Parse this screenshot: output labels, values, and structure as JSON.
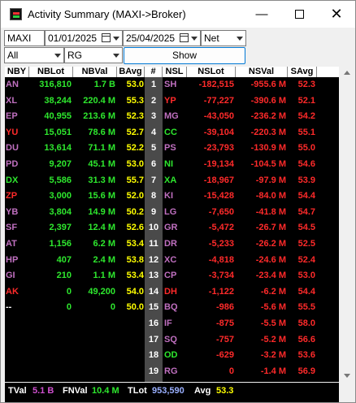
{
  "window": {
    "title": "Activity Summary (MAXI->Broker)"
  },
  "filters": {
    "code": "MAXI",
    "date_from": "01/01/2025",
    "date_to": "25/04/2025",
    "mode": "Net",
    "scope": "All",
    "board": "RG",
    "show_label": "Show"
  },
  "table": {
    "headers": [
      "NBY",
      "NBLot",
      "NBVal",
      "BAvg",
      "#",
      "NSL",
      "NSLot",
      "NSVal",
      "SAvg"
    ],
    "rows": [
      {
        "nby": "AN",
        "nblot": "316,810",
        "nbval": "1.7 B",
        "bavg": "53.0",
        "n": "1",
        "nsl": "SH",
        "nslot": "-182,515",
        "nsval": "-955.6 M",
        "savg": "52.3"
      },
      {
        "nby": "XL",
        "nblot": "38,244",
        "nbval": "220.4 M",
        "bavg": "55.3",
        "n": "2",
        "nsl": "YP",
        "nslot": "-77,227",
        "nsval": "-390.6 M",
        "savg": "52.1"
      },
      {
        "nby": "EP",
        "nblot": "40,955",
        "nbval": "213.6 M",
        "bavg": "52.3",
        "n": "3",
        "nsl": "MG",
        "nslot": "-43,050",
        "nsval": "-236.2 M",
        "savg": "54.2"
      },
      {
        "nby": "YU",
        "nblot": "15,051",
        "nbval": "78.6 M",
        "bavg": "52.7",
        "n": "4",
        "nsl": "CC",
        "nslot": "-39,104",
        "nsval": "-220.3 M",
        "savg": "55.1"
      },
      {
        "nby": "DU",
        "nblot": "13,614",
        "nbval": "71.1 M",
        "bavg": "52.2",
        "n": "5",
        "nsl": "PS",
        "nslot": "-23,793",
        "nsval": "-130.9 M",
        "savg": "55.0"
      },
      {
        "nby": "PD",
        "nblot": "9,207",
        "nbval": "45.1 M",
        "bavg": "53.0",
        "n": "6",
        "nsl": "NI",
        "nslot": "-19,134",
        "nsval": "-104.5 M",
        "savg": "54.6"
      },
      {
        "nby": "DX",
        "nblot": "5,586",
        "nbval": "31.3 M",
        "bavg": "55.7",
        "n": "7",
        "nsl": "XA",
        "nslot": "-18,967",
        "nsval": "-97.9 M",
        "savg": "53.9"
      },
      {
        "nby": "ZP",
        "nblot": "3,000",
        "nbval": "15.6 M",
        "bavg": "52.0",
        "n": "8",
        "nsl": "KI",
        "nslot": "-15,428",
        "nsval": "-84.0 M",
        "savg": "54.4"
      },
      {
        "nby": "YB",
        "nblot": "3,804",
        "nbval": "14.9 M",
        "bavg": "50.2",
        "n": "9",
        "nsl": "LG",
        "nslot": "-7,650",
        "nsval": "-41.8 M",
        "savg": "54.7"
      },
      {
        "nby": "SF",
        "nblot": "2,397",
        "nbval": "12.4 M",
        "bavg": "52.6",
        "n": "10",
        "nsl": "GR",
        "nslot": "-5,472",
        "nsval": "-26.7 M",
        "savg": "54.5"
      },
      {
        "nby": "AT",
        "nblot": "1,156",
        "nbval": "6.2 M",
        "bavg": "53.4",
        "n": "11",
        "nsl": "DR",
        "nslot": "-5,233",
        "nsval": "-26.2 M",
        "savg": "52.5"
      },
      {
        "nby": "HP",
        "nblot": "407",
        "nbval": "2.4 M",
        "bavg": "53.8",
        "n": "12",
        "nsl": "XC",
        "nslot": "-4,818",
        "nsval": "-24.6 M",
        "savg": "52.4"
      },
      {
        "nby": "GI",
        "nblot": "210",
        "nbval": "1.1 M",
        "bavg": "53.4",
        "n": "13",
        "nsl": "CP",
        "nslot": "-3,734",
        "nsval": "-23.4 M",
        "savg": "53.0"
      },
      {
        "nby": "AK",
        "nblot": "0",
        "nbval": "49,200",
        "bavg": "54.0",
        "n": "14",
        "nsl": "DH",
        "nslot": "-1,122",
        "nsval": "-6.2 M",
        "savg": "54.4"
      },
      {
        "nby": "--",
        "nblot": "0",
        "nbval": "0",
        "bavg": "50.0",
        "n": "15",
        "nsl": "BQ",
        "nslot": "-986",
        "nsval": "-5.6 M",
        "savg": "55.5"
      },
      {
        "nby": "",
        "nblot": "",
        "nbval": "",
        "bavg": "",
        "n": "16",
        "nsl": "IF",
        "nslot": "-875",
        "nsval": "-5.5 M",
        "savg": "58.0"
      },
      {
        "nby": "",
        "nblot": "",
        "nbval": "",
        "bavg": "",
        "n": "17",
        "nsl": "SQ",
        "nslot": "-757",
        "nsval": "-5.2 M",
        "savg": "56.6"
      },
      {
        "nby": "",
        "nblot": "",
        "nbval": "",
        "bavg": "",
        "n": "18",
        "nsl": "OD",
        "nslot": "-629",
        "nsval": "-3.2 M",
        "savg": "53.6"
      },
      {
        "nby": "",
        "nblot": "",
        "nbval": "",
        "bavg": "",
        "n": "19",
        "nsl": "RG",
        "nslot": "0",
        "nsval": "-1.4 M",
        "savg": "56.9"
      }
    ],
    "code_colors": {
      "AN": "#c070c0",
      "XL": "#c070c0",
      "EP": "#c070c0",
      "YU": "#ff2a2a",
      "DU": "#c070c0",
      "PD": "#c070c0",
      "DX": "#2ee82e",
      "ZP": "#ff2a2a",
      "YB": "#c070c0",
      "SF": "#c070c0",
      "AT": "#c070c0",
      "HP": "#c070c0",
      "GI": "#c070c0",
      "AK": "#ff2a2a",
      "--": "#ffffff",
      "SH": "#c070c0",
      "YP": "#ff2a2a",
      "MG": "#c070c0",
      "CC": "#2ee82e",
      "PS": "#c070c0",
      "NI": "#2ee82e",
      "XA": "#2ee82e",
      "KI": "#c070c0",
      "LG": "#c070c0",
      "GR": "#c070c0",
      "DR": "#c070c0",
      "XC": "#c070c0",
      "CP": "#c070c0",
      "DH": "#ff2a2a",
      "BQ": "#c070c0",
      "IF": "#c070c0",
      "SQ": "#c070c0",
      "OD": "#2ee82e",
      "RG": "#c070c0"
    }
  },
  "footer": {
    "tval_label": "TVal",
    "tval": "5.1 B",
    "fnval_label": "FNVal",
    "fnval": "10.4 M",
    "tlot_label": "TLot",
    "tlot": "953,590",
    "avg_label": "Avg",
    "avg": "53.3"
  },
  "colors": {
    "buy": "#2ee82e",
    "sell": "#ff2a2a",
    "avg_buy": "#ffff00",
    "avg_sell": "#ff2a2a",
    "foreign": "#c070c0",
    "local": "#2ee82e",
    "gov": "#ff2a2a"
  }
}
